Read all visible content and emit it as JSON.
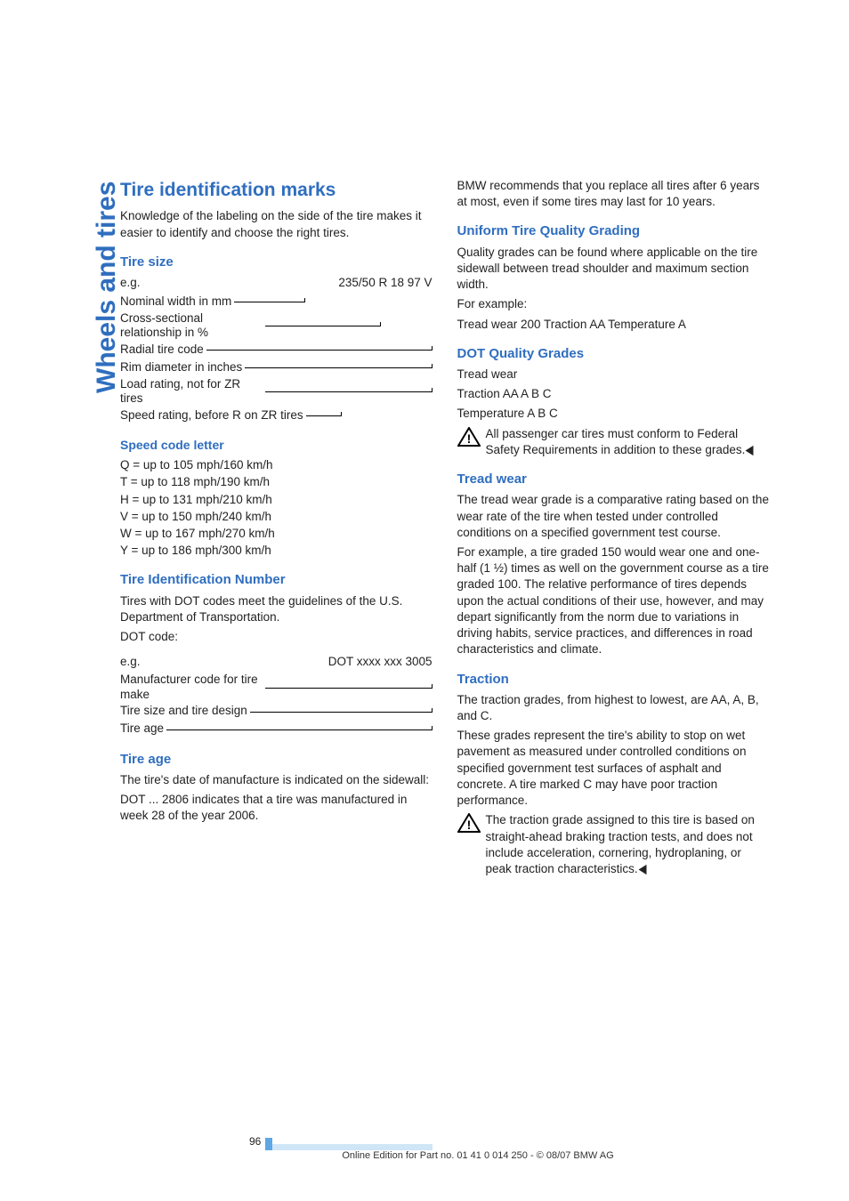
{
  "sidebar_tab": "Wheels and tires",
  "left": {
    "title": "Tire identification marks",
    "intro": "Knowledge of the labeling on the side of the tire makes it easier to identify and choose the right tires.",
    "tire_size": {
      "heading": "Tire size",
      "eg_label": "e.g.",
      "eg_value": "235/50 R 18 97 V",
      "rows": [
        "Nominal width in mm",
        "Cross-sectional relationship in %",
        "Radial tire code",
        "Rim diameter in inches",
        "Load rating, not for ZR tires",
        "Speed rating, before R on ZR tires"
      ]
    },
    "speed_code": {
      "heading": "Speed code letter",
      "items": [
        "Q  = up to 105 mph/160 km/h",
        "T  = up to 118 mph/190 km/h",
        "H  = up to 131 mph/210 km/h",
        "V  = up to 150 mph/240 km/h",
        "W = up to 167 mph/270 km/h",
        "Y  = up to 186 mph/300 km/h"
      ]
    },
    "tin": {
      "heading": "Tire Identification Number",
      "p1": "Tires with DOT codes meet the guidelines of the U.S. Department of Transportation.",
      "p2": "DOT code:",
      "eg_label": "e.g.",
      "eg_value": "DOT xxxx xxx 3005",
      "rows": [
        "Manufacturer code for tire make",
        "Tire size and tire design",
        "Tire age"
      ]
    },
    "tire_age": {
      "heading": "Tire age",
      "p1": "The tire's date of manufacture is indicated on the sidewall:",
      "p2": "DOT ... 2806 indicates that a tire was manufactured in week 28 of the year 2006."
    }
  },
  "right": {
    "rec": "BMW recommends that you replace all tires after 6 years at most, even if some tires may last for 10 years.",
    "utqg": {
      "heading": "Uniform Tire Quality Grading",
      "p1": "Quality grades can be found where applicable on the tire sidewall between tread shoulder and maximum section width.",
      "p2": "For example:",
      "p3": "Tread wear 200 Traction AA Temperature A"
    },
    "dot": {
      "heading": "DOT Quality Grades",
      "l1": "Tread wear",
      "l2": "Traction AA A B C",
      "l3": "Temperature A B C",
      "warn": "All passenger car tires must conform to Federal Safety Requirements in addition to these grades."
    },
    "tread": {
      "heading": "Tread wear",
      "p1": "The tread wear grade is a comparative rating based on the wear rate of the tire when tested under controlled conditions on a specified government test course.",
      "p2": "For example, a tire graded 150 would wear one and one-half (1 ½) times as well on the government course as a tire graded 100. The relative performance of tires depends upon the actual conditions of their use, however, and may depart significantly from the norm due to variations in driving habits, service practices, and differences in road characteristics and climate."
    },
    "traction": {
      "heading": "Traction",
      "p1": "The traction grades, from highest to lowest, are AA, A, B, and C.",
      "p2": "These grades represent the tire's ability to stop on wet pavement as measured under controlled conditions on specified government test surfaces of asphalt and concrete. A tire marked C may have poor traction performance.",
      "warn": "The traction grade assigned to this tire is based on straight-ahead braking traction tests, and does not include acceleration, cornering, hydroplaning, or peak traction characteristics."
    }
  },
  "page_number": "96",
  "footer": "Online Edition for Part no. 01 41 0 014 250 - © 08/07 BMW AG"
}
